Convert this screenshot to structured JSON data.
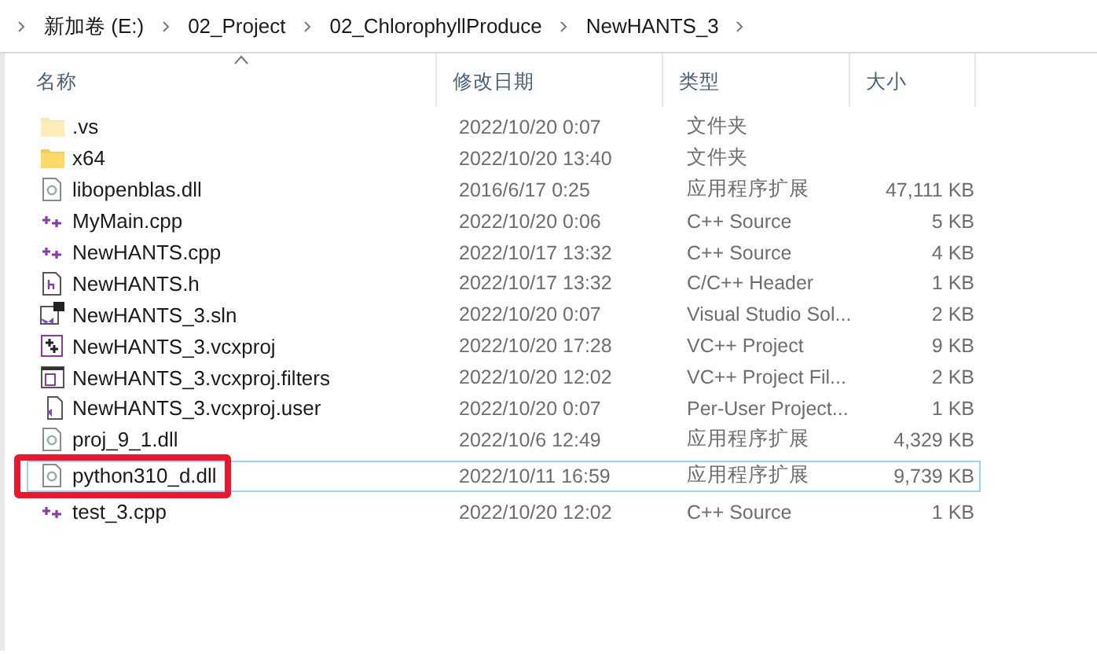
{
  "breadcrumb": [
    "新加卷 (E:)",
    "02_Project",
    "02_ChlorophyllProduce",
    "NewHANTS_3"
  ],
  "columns": [
    {
      "label": "名称",
      "sorted": true
    },
    {
      "label": "修改日期",
      "sorted": false
    },
    {
      "label": "类型",
      "sorted": false
    },
    {
      "label": "大小",
      "sorted": false
    }
  ],
  "files": [
    {
      "name": ".vs",
      "kind": "folder",
      "hidden": true,
      "date": "2022/10/20 0:07",
      "type": "文件夹",
      "selected": false
    },
    {
      "name": "x64",
      "kind": "folder",
      "hidden": false,
      "date": "2022/10/20 13:40",
      "type": "文件夹",
      "selected": false
    },
    {
      "name": "libopenblas.dll",
      "kind": "dll",
      "hidden": false,
      "date": "2016/6/17 0:25",
      "type": "应用程序扩展",
      "size": "47,111 KB",
      "selected": false
    },
    {
      "name": "MyMain.cpp",
      "kind": "cpp",
      "hidden": false,
      "date": "2022/10/20 0:06",
      "type": "C++ Source",
      "size": "5 KB",
      "selected": false
    },
    {
      "name": "NewHANTS.cpp",
      "kind": "cpp",
      "hidden": false,
      "date": "2022/10/17 13:32",
      "type": "C++ Source",
      "size": "4 KB",
      "selected": false
    },
    {
      "name": "NewHANTS.h",
      "kind": "header",
      "hidden": false,
      "date": "2022/10/17 13:32",
      "type": "C/C++ Header",
      "size": "1 KB",
      "selected": false
    },
    {
      "name": "NewHANTS_3.sln",
      "kind": "sln",
      "hidden": false,
      "date": "2022/10/20 0:07",
      "type": "Visual Studio Sol...",
      "size": "2 KB",
      "selected": false
    },
    {
      "name": "NewHANTS_3.vcxproj",
      "kind": "vcxproj",
      "hidden": false,
      "date": "2022/10/20 17:28",
      "type": "VC++ Project",
      "size": "9 KB",
      "selected": false
    },
    {
      "name": "NewHANTS_3.vcxproj.filters",
      "kind": "filters",
      "hidden": false,
      "date": "2022/10/20 12:02",
      "type": "VC++ Project Fil...",
      "size": "2 KB",
      "selected": false
    },
    {
      "name": "NewHANTS_3.vcxproj.user",
      "kind": "user",
      "hidden": false,
      "date": "2022/10/20 0:07",
      "type": "Per-User Project...",
      "size": "1 KB",
      "selected": false
    },
    {
      "name": "proj_9_1.dll",
      "kind": "dll",
      "hidden": false,
      "date": "2022/10/6 12:49",
      "type": "应用程序扩展",
      "size": "4,329 KB",
      "selected": false
    },
    {
      "name": "python310_d.dll",
      "kind": "dll",
      "hidden": false,
      "date": "2022/10/11 16:59",
      "type": "应用程序扩展",
      "size": "9,739 KB",
      "selected": true,
      "annotated": true
    },
    {
      "name": "test_3.cpp",
      "kind": "cpp",
      "hidden": false,
      "date": "2022/10/20 12:02",
      "type": "C++ Source",
      "size": "1 KB",
      "selected": false
    }
  ]
}
